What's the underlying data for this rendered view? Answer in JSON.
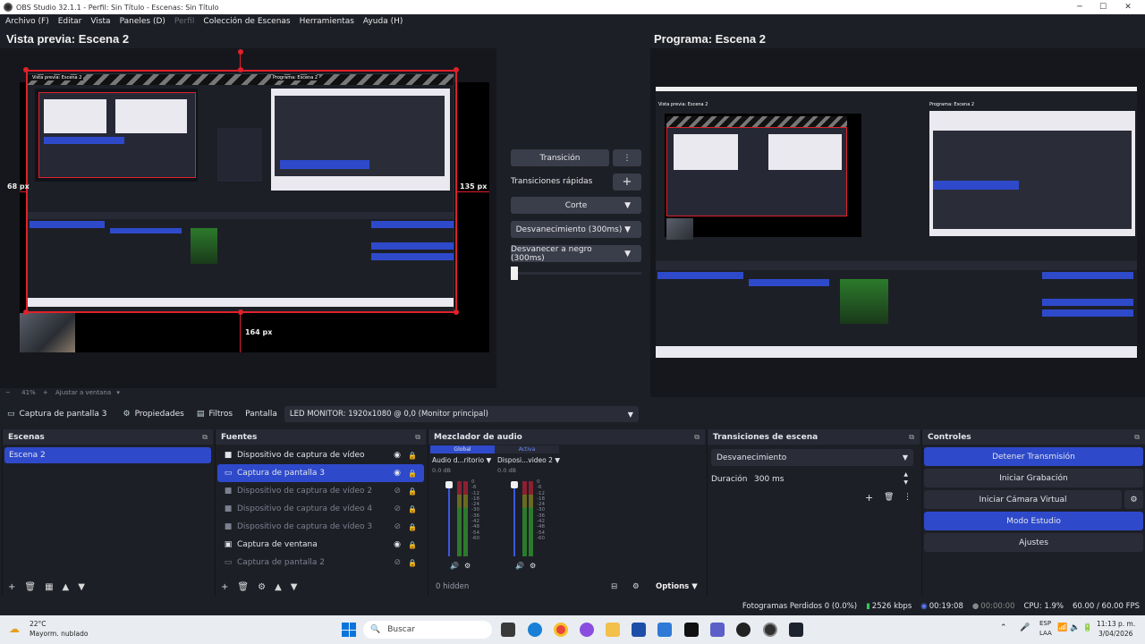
{
  "window": {
    "title": "OBS Studio 32.1.1 - Perfil: Sin Título - Escenas: Sin Título",
    "minimize": "─",
    "maximize": "☐",
    "close": "✕"
  },
  "menu": [
    "Archivo (F)",
    "Editar",
    "Vista",
    "Paneles (D)",
    "Perfil",
    "Colección de Escenas",
    "Herramientas",
    "Ayuda (H)"
  ],
  "preview": {
    "title": "Vista previa: Escena 2",
    "left_px": "68 px",
    "right_px": "135 px",
    "bottom_px": "164 px",
    "zoom": "41%",
    "fit": "Ajustar a ventana",
    "inner_preview_title": "Vista previa: Escena 2",
    "inner_program_title": "Programa: Escena 2"
  },
  "program": {
    "title": "Programa: Escena 2",
    "inner_preview_title": "Vista previa: Escena 2",
    "inner_program_title": "Programa: Escena 2"
  },
  "transitions_center": {
    "transition_button": "Transición",
    "quick_label": "Transiciones rápidas",
    "cut": "Corte",
    "fade": "Desvanecimiento (300ms)",
    "fade_black": "Desvanecer a negro (300ms)"
  },
  "source_toolbar": {
    "current_source": "Captura de pantalla 3",
    "properties": "Propiedades",
    "filters": "Filtros",
    "display_label": "Pantalla",
    "display_value": "LED MONITOR: 1920x1080 @ 0,0 (Monitor principal)"
  },
  "scenes": {
    "title": "Escenas",
    "items": [
      "Escena 2"
    ]
  },
  "sources": {
    "title": "Fuentes",
    "items": [
      {
        "name": "Dispositivo de captura de vídeo",
        "icon": "camera-icon",
        "visible": true,
        "selected": false
      },
      {
        "name": "Captura de pantalla 3",
        "icon": "monitor-icon",
        "visible": true,
        "selected": true
      },
      {
        "name": "Dispositivo de captura de vídeo 2",
        "icon": "camera-icon",
        "visible": false,
        "selected": false
      },
      {
        "name": "Dispositivo de captura de vídeo 4",
        "icon": "camera-icon",
        "visible": false,
        "selected": false
      },
      {
        "name": "Dispositivo de captura de vídeo 3",
        "icon": "camera-icon",
        "visible": false,
        "selected": false
      },
      {
        "name": "Captura de ventana",
        "icon": "window-icon",
        "visible": true,
        "selected": false
      },
      {
        "name": "Captura de pantalla 2",
        "icon": "monitor-icon",
        "visible": false,
        "selected": false
      }
    ]
  },
  "mixer": {
    "title": "Mezclador de audio",
    "tab_global": "Global",
    "tab_active": "Activa",
    "hidden": "0 hidden",
    "options": "Options",
    "channels": [
      {
        "name": "Audio d...ritorio",
        "db": "0.0 dB"
      },
      {
        "name": "Disposi...video 2",
        "db": "0.0 dB"
      }
    ],
    "scale": [
      "0",
      "-6",
      "-12",
      "-18",
      "-24",
      "-30",
      "-36",
      "-42",
      "-48",
      "-54",
      "-60"
    ]
  },
  "scene_transitions": {
    "title": "Transiciones de escena",
    "type": "Desvanecimiento",
    "duration_label": "Duración",
    "duration_value": "300 ms"
  },
  "controls": {
    "title": "Controles",
    "stop_stream": "Detener Transmisión",
    "start_record": "Iniciar Grabación",
    "virtual_cam": "Iniciar Cámara Virtual",
    "studio_mode": "Modo Estudio",
    "settings": "Ajustes"
  },
  "status": {
    "dropped": "Fotogramas Perdidos 0 (0.0%)",
    "bitrate": "2526 kbps",
    "stream_time": "00:19:08",
    "rec_time": "00:00:00",
    "cpu": "CPU: 1.9%",
    "fps": "60.00 / 60.00 FPS"
  },
  "taskbar": {
    "weather_temp": "22°C",
    "weather_desc": "Mayorm. nublado",
    "search": "Buscar",
    "lang1": "ESP",
    "lang2": "LAA",
    "time": "11:13 p. m.",
    "date": "3/04/2026"
  },
  "colors": {
    "accent": "#2e4acb",
    "bg": "#1d1f26",
    "red": "#e0202a"
  }
}
